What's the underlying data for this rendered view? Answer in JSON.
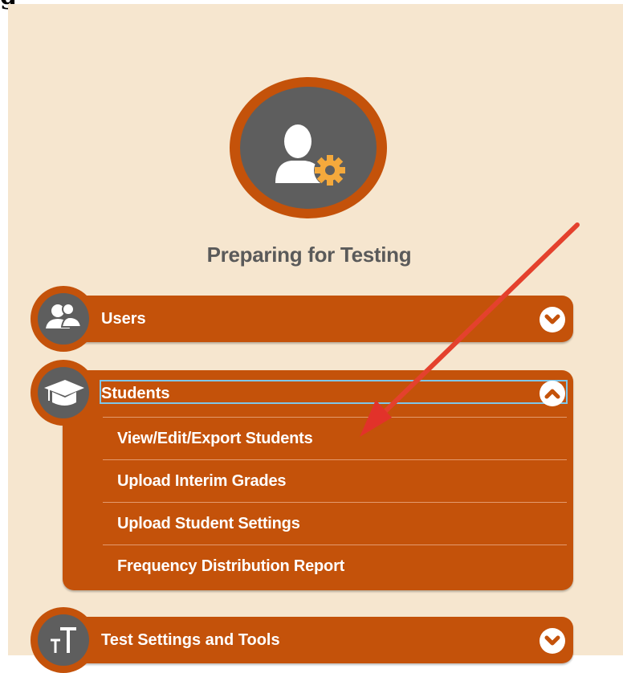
{
  "page": {
    "top_cut_text": "g"
  },
  "section": {
    "title": "Preparing for Testing"
  },
  "accordion": {
    "users": {
      "label": "Users",
      "icon": "users-icon",
      "state": "collapsed"
    },
    "students": {
      "label": "Students",
      "icon": "graduation-cap-icon",
      "state": "expanded",
      "items": [
        {
          "label": "View/Edit/Export Students"
        },
        {
          "label": "Upload Interim Grades"
        },
        {
          "label": "Upload Student Settings"
        },
        {
          "label": "Frequency Distribution Report"
        }
      ]
    },
    "test_settings": {
      "label": "Test Settings and Tools",
      "icon": "text-size-icon",
      "state": "collapsed"
    }
  },
  "colors": {
    "accent": "#c4520a",
    "panel_bg": "#f6e6cf",
    "icon_bg": "#5e5e5e",
    "gear": "#f4a93c",
    "annotation_arrow": "#e8382a",
    "focus": "#7fc6e8"
  }
}
